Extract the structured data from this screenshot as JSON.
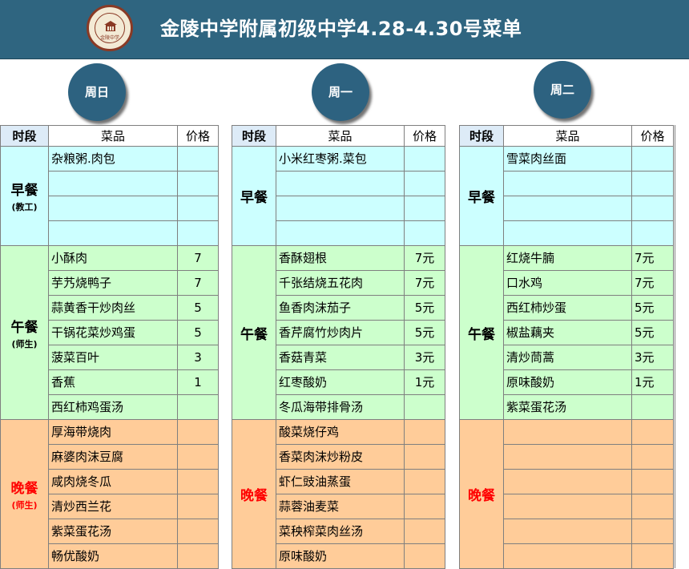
{
  "header": {
    "title": "金陵中学附属初级中学4.28-4.30号菜单",
    "logo_text": "金陵中学"
  },
  "columns": {
    "period": "时段",
    "dish": "菜品",
    "price": "价格"
  },
  "days": [
    {
      "name": "周日",
      "breakfast": {
        "label": "早餐",
        "sub": "(教工)",
        "items": [
          {
            "dish": "杂粮粥.肉包",
            "price": ""
          },
          {
            "dish": "",
            "price": ""
          },
          {
            "dish": "",
            "price": ""
          },
          {
            "dish": "",
            "price": ""
          }
        ]
      },
      "lunch": {
        "label": "午餐",
        "sub": "(师生)",
        "items": [
          {
            "dish": "小酥肉",
            "price": "7"
          },
          {
            "dish": "芋艿烧鸭子",
            "price": "7"
          },
          {
            "dish": "蒜黄香干炒肉丝",
            "price": "5"
          },
          {
            "dish": "干锅花菜炒鸡蛋",
            "price": "5"
          },
          {
            "dish": "菠菜百叶",
            "price": "3"
          },
          {
            "dish": "香蕉",
            "price": "1"
          },
          {
            "dish": "西红柿鸡蛋汤",
            "price": ""
          }
        ]
      },
      "dinner": {
        "label": "晚餐",
        "sub": "(师生)",
        "items": [
          {
            "dish": "厚海带烧肉",
            "price": ""
          },
          {
            "dish": "麻婆肉沫豆腐",
            "price": ""
          },
          {
            "dish": "咸肉烧冬瓜",
            "price": ""
          },
          {
            "dish": "清炒西兰花",
            "price": ""
          },
          {
            "dish": "紫菜蛋花汤",
            "price": ""
          },
          {
            "dish": "畅优酸奶",
            "price": ""
          }
        ]
      }
    },
    {
      "name": "周一",
      "breakfast": {
        "label": "早餐",
        "sub": "",
        "items": [
          {
            "dish": "小米红枣粥.菜包",
            "price": ""
          },
          {
            "dish": "",
            "price": ""
          },
          {
            "dish": "",
            "price": ""
          },
          {
            "dish": "",
            "price": ""
          }
        ]
      },
      "lunch": {
        "label": "午餐",
        "sub": "",
        "items": [
          {
            "dish": "香酥翅根",
            "price": "7元"
          },
          {
            "dish": "千张结烧五花肉",
            "price": "7元"
          },
          {
            "dish": "鱼香肉沫茄子",
            "price": "5元"
          },
          {
            "dish": "香芹腐竹炒肉片",
            "price": "5元"
          },
          {
            "dish": "香菇青菜",
            "price": "3元"
          },
          {
            "dish": "红枣酸奶",
            "price": "1元"
          },
          {
            "dish": "冬瓜海带排骨汤",
            "price": ""
          }
        ]
      },
      "dinner": {
        "label": "晚餐",
        "sub": "",
        "items": [
          {
            "dish": "酸菜烧仔鸡",
            "price": ""
          },
          {
            "dish": "香菜肉沫炒粉皮",
            "price": ""
          },
          {
            "dish": "虾仁豉油蒸蛋",
            "price": ""
          },
          {
            "dish": "蒜蓉油麦菜",
            "price": ""
          },
          {
            "dish": "菜秧榨菜肉丝汤",
            "price": ""
          },
          {
            "dish": "原味酸奶",
            "price": ""
          }
        ]
      }
    },
    {
      "name": "周二",
      "breakfast": {
        "label": "早餐",
        "sub": "",
        "items": [
          {
            "dish": "雪菜肉丝面",
            "price": ""
          },
          {
            "dish": "",
            "price": ""
          },
          {
            "dish": "",
            "price": ""
          },
          {
            "dish": "",
            "price": ""
          }
        ]
      },
      "lunch": {
        "label": "午餐",
        "sub": "",
        "items": [
          {
            "dish": "红烧牛腩",
            "price": "7元"
          },
          {
            "dish": "口水鸡",
            "price": "7元"
          },
          {
            "dish": "西红柿炒蛋",
            "price": "5元"
          },
          {
            "dish": "椒盐藕夹",
            "price": "5元"
          },
          {
            "dish": "清炒茼蒿",
            "price": "3元"
          },
          {
            "dish": "原味酸奶",
            "price": "1元"
          },
          {
            "dish": "紫菜蛋花汤",
            "price": ""
          }
        ]
      },
      "dinner": {
        "label": "晚餐",
        "sub": "",
        "items": [
          {
            "dish": "",
            "price": ""
          },
          {
            "dish": "",
            "price": ""
          },
          {
            "dish": "",
            "price": ""
          },
          {
            "dish": "",
            "price": ""
          },
          {
            "dish": "",
            "price": ""
          },
          {
            "dish": "",
            "price": ""
          }
        ]
      }
    }
  ]
}
